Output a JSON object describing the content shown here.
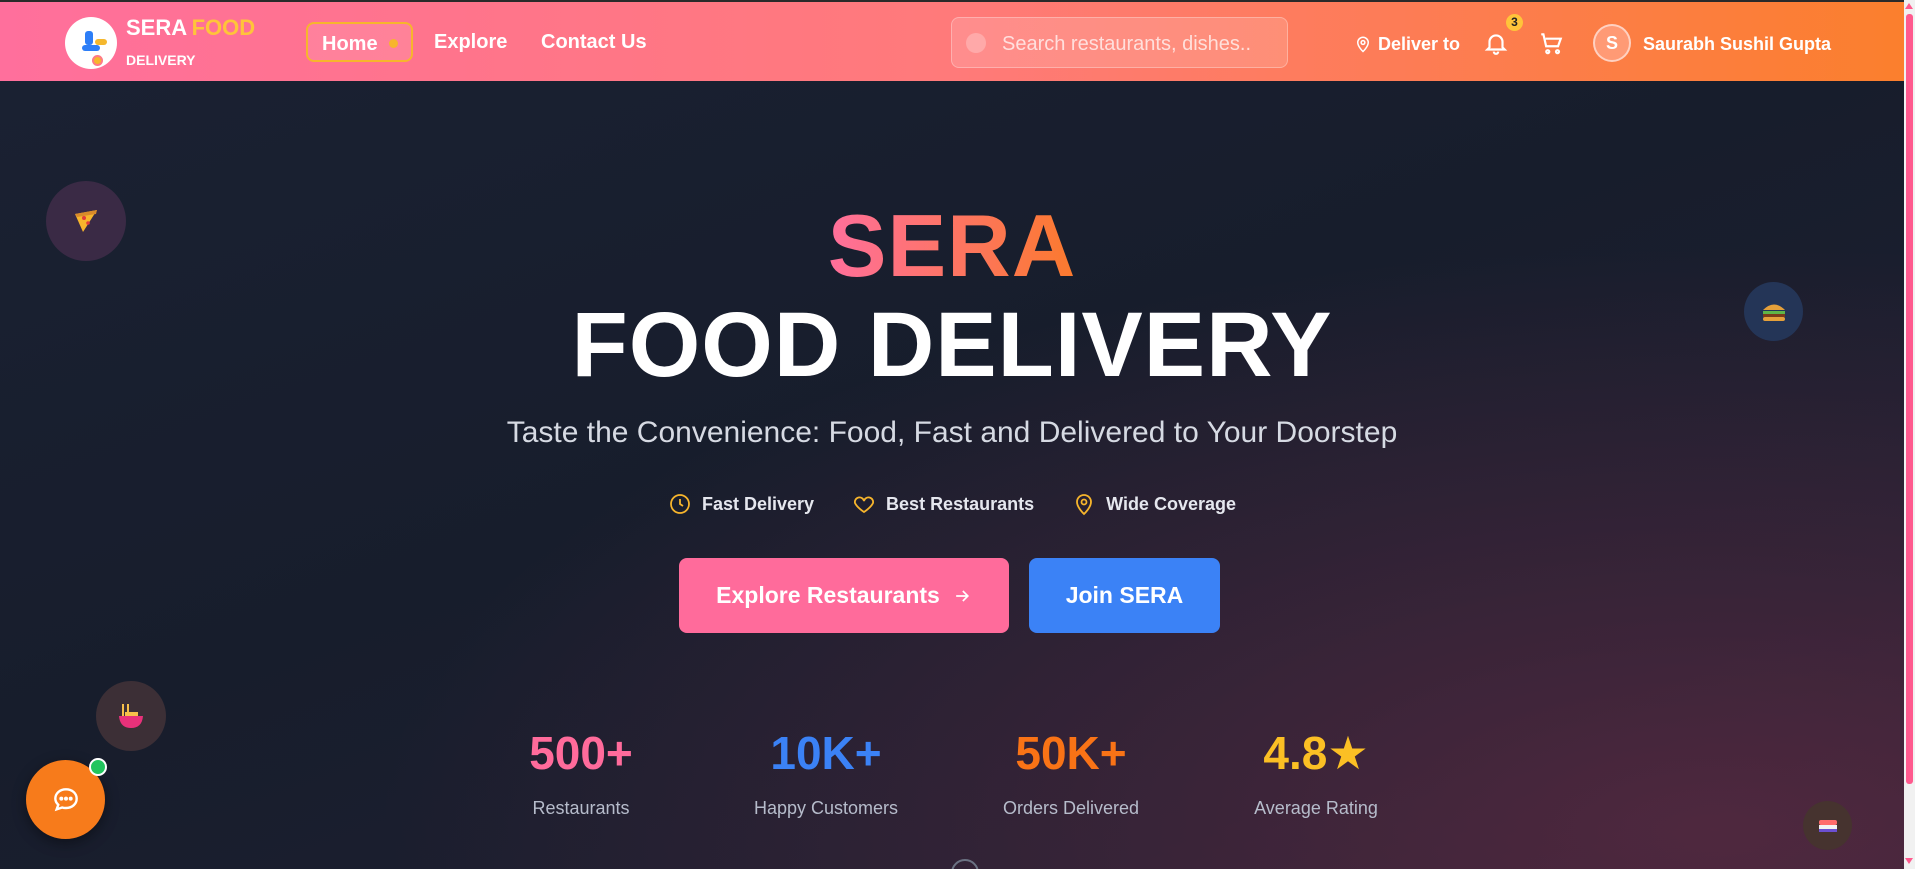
{
  "header": {
    "brand": {
      "name": "SERA",
      "accent": "FOOD",
      "sub": "DELIVERY"
    },
    "nav": [
      {
        "label": "Home",
        "active": true
      },
      {
        "label": "Explore",
        "active": false
      },
      {
        "label": "Contact Us",
        "active": false
      }
    ],
    "search": {
      "placeholder": "Search restaurants, dishes.."
    },
    "deliver_label": "Deliver to",
    "notification_count": "3",
    "user": {
      "initial": "S",
      "name": "Saurabh Sushil Gupta"
    }
  },
  "hero": {
    "title_top": "SERA",
    "title_main": "FOOD DELIVERY",
    "subtitle": "Taste the Convenience: Food, Fast and Delivered to Your Doorstep",
    "features": [
      {
        "label": "Fast Delivery",
        "icon": "clock-icon"
      },
      {
        "label": "Best Restaurants",
        "icon": "heart-icon"
      },
      {
        "label": "Wide Coverage",
        "icon": "map-pin-icon"
      }
    ],
    "cta_primary": "Explore Restaurants",
    "cta_secondary": "Join SERA",
    "floating_icons": [
      "pizza-icon",
      "burger-icon",
      "noodles-icon",
      "sushi-icon"
    ]
  },
  "stats": [
    {
      "value": "500+",
      "label": "Restaurants",
      "color": "#ff6b9b"
    },
    {
      "value": "10K+",
      "label": "Happy Customers",
      "color": "#3b82f6"
    },
    {
      "value": "50K+",
      "label": "Orders Delivered",
      "color": "#f97316"
    },
    {
      "value": "4.8★",
      "label": "Average Rating",
      "color": "#fbbf24"
    }
  ],
  "colors": {
    "pink": "#ff6b9b",
    "orange": "#f97316",
    "blue": "#3b82f6",
    "gold": "#fbbf24"
  }
}
